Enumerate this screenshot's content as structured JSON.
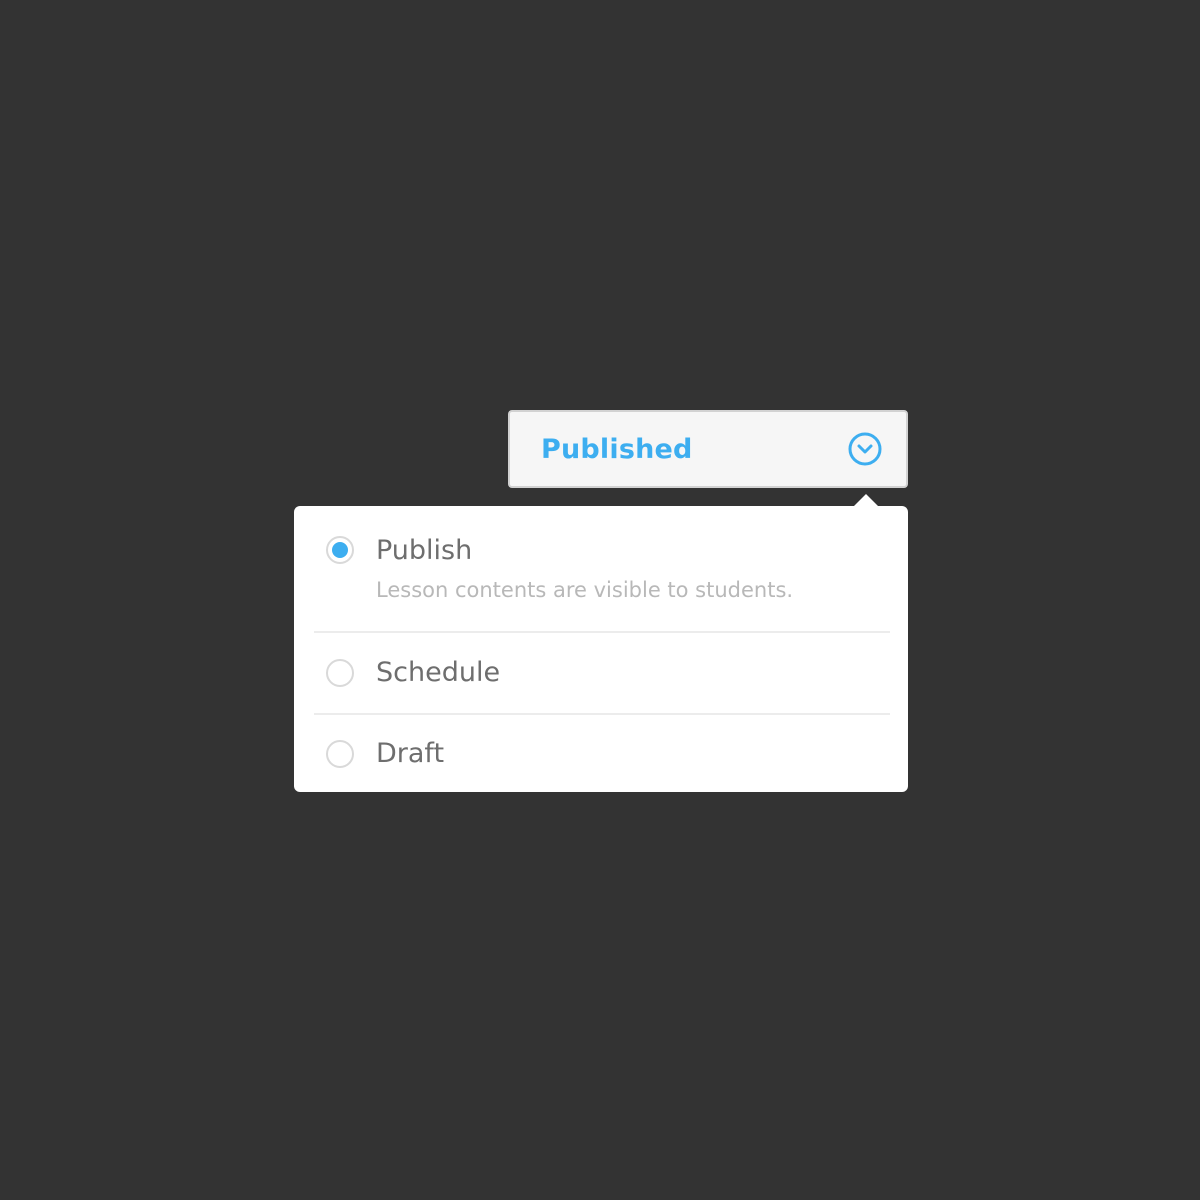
{
  "select": {
    "value": "Published",
    "icon": "chevron-down-circle-icon",
    "accent_color": "#3daef0"
  },
  "options": [
    {
      "label": "Publish",
      "description": "Lesson contents are visible to students.",
      "selected": true
    },
    {
      "label": "Schedule",
      "selected": false
    },
    {
      "label": "Draft",
      "selected": false
    }
  ]
}
